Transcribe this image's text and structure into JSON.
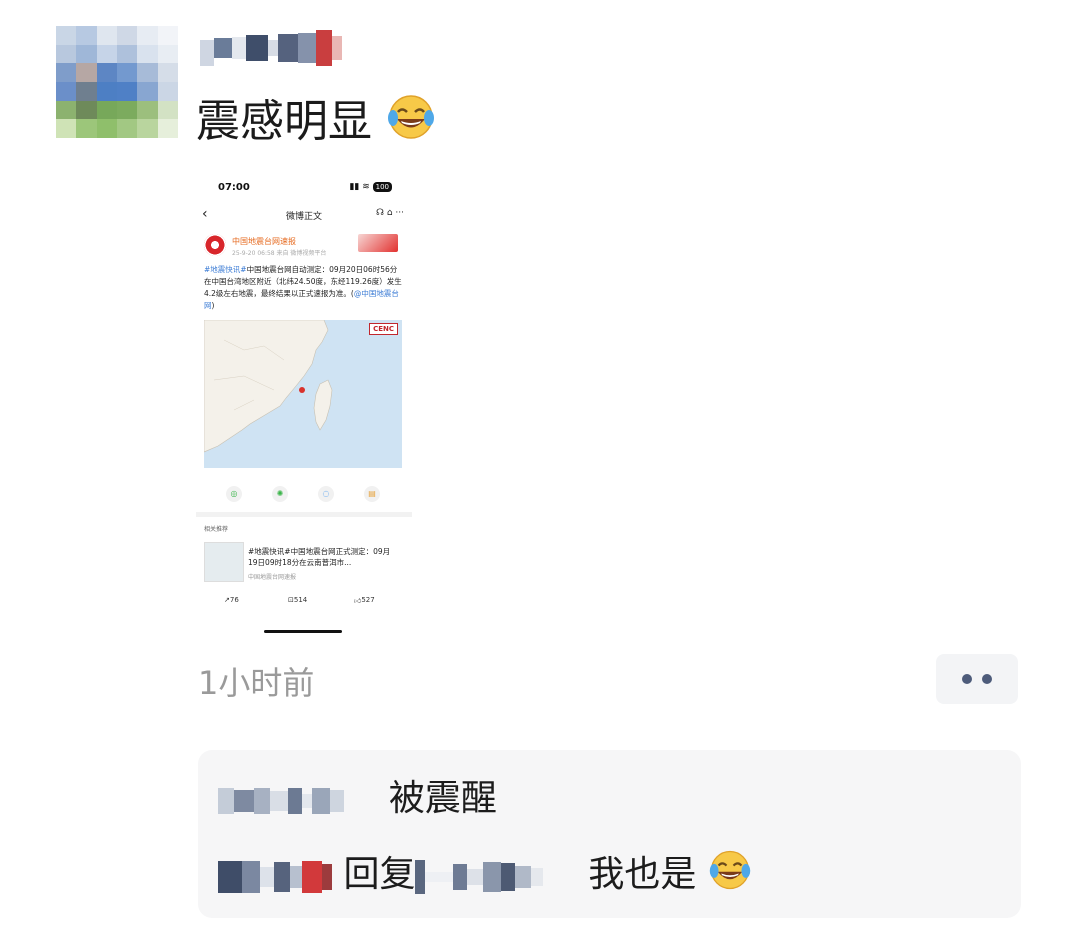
{
  "post": {
    "text": "震感明显",
    "emoji": "tears-of-joy-emoji",
    "timestamp": "1小时前"
  },
  "screenshot": {
    "status_time": "07:00",
    "battery": "100",
    "nav_title": "微博正文",
    "account_name": "中国地震台网速报",
    "account_meta": "25-9-20 06:58 来自 微博视频平台",
    "body_tag": "#地震快讯#",
    "body_text": "中国地震台网自动测定：09月20日06时56分在中国台湾地区附近（北纬24.50度，东经119.26度）发生4.2级左右地震，最终结果以正式速报为准。(",
    "body_link": "@中国地震台网",
    "body_end": ")",
    "map_logo": "CENC",
    "related_label": "相关推荐",
    "related_text": "#地震快讯#中国地震台网正式测定：09月19日09时18分在云南普洱市...",
    "related_source": "中国地震台网速报",
    "repost_count": "76",
    "comment_count": "514",
    "like_count": "527"
  },
  "comments": [
    {
      "text": "被震醒"
    },
    {
      "reply_word": "回复",
      "text": "我也是",
      "emoji": "tears-of-joy-emoji"
    }
  ],
  "colors": {
    "timestamp": "#9a9a9a",
    "more_dots": "#4d5b7a",
    "comment_bg": "#f6f6f7",
    "link": "#3a7bd5"
  }
}
